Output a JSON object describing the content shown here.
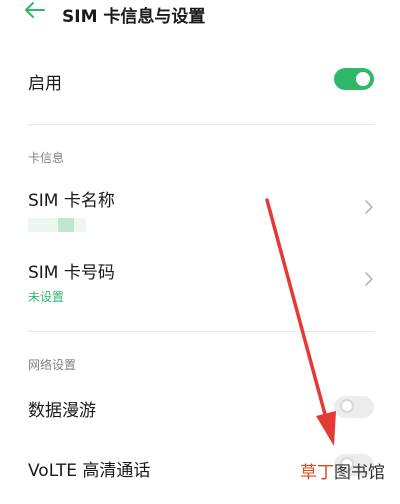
{
  "header": {
    "back_icon": "back-arrow-icon",
    "title": "SIM 卡信息与设置"
  },
  "enable": {
    "label": "启用",
    "toggle_on": true
  },
  "sim_info": {
    "section_title": "卡信息",
    "name": {
      "label": "SIM 卡名称",
      "chevron_icon": "chevron-right-icon"
    },
    "number": {
      "label": "SIM 卡号码",
      "status": "未设置",
      "chevron_icon": "chevron-right-icon"
    }
  },
  "network": {
    "section_title": "网络设置",
    "roaming": {
      "label": "数据漫游",
      "toggle_on": false
    },
    "volte": {
      "label": "VoLTE 高清通话",
      "toggle_on": false
    }
  },
  "watermark": {
    "part1": "草丁",
    "part2": "图书馆"
  },
  "colors": {
    "accent": "#2fb869",
    "status_text": "#2fb869",
    "arrow": "#e53935",
    "watermark_red": "#e0491f"
  }
}
